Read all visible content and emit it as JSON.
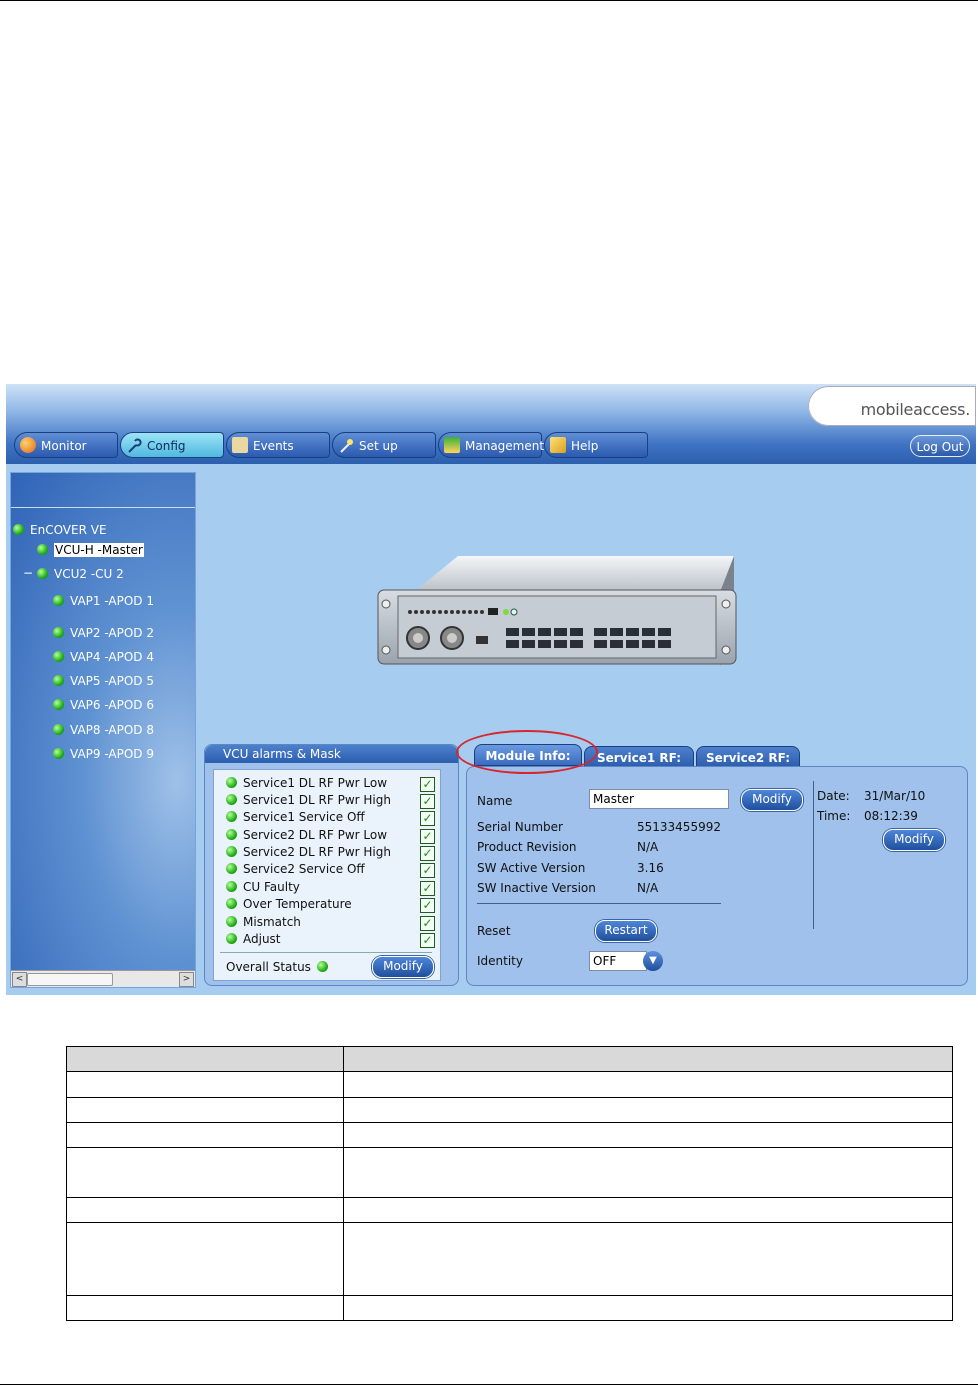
{
  "app": {
    "logo_text": "mobileaccess.",
    "logout_label": "Log Out",
    "tabs": [
      {
        "label": "Monitor",
        "icon": "monitor-icon"
      },
      {
        "label": "Config",
        "icon": "wrench-icon"
      },
      {
        "label": "Events",
        "icon": "events-icon"
      },
      {
        "label": "Set up",
        "icon": "wand-icon"
      },
      {
        "label": "Management",
        "icon": "management-icon"
      },
      {
        "label": "Help",
        "icon": "help-book-icon"
      }
    ],
    "active_tab": "Config"
  },
  "tree": {
    "root": "EnCOVER VE",
    "master": "VCU-H -Master",
    "vcu2": "VCU2 -CU 2",
    "collapse_symbol": "−",
    "items": [
      "VAP1 -APOD 1",
      "VAP2 -APOD 2",
      "VAP4 -APOD 4",
      "VAP5 -APOD 5",
      "VAP6 -APOD 6",
      "VAP8 -APOD 8",
      "VAP9 -APOD 9"
    ],
    "scroll_left": "<",
    "scroll_right": ">"
  },
  "alarms": {
    "title": "VCU alarms & Mask",
    "items": [
      "Service1 DL RF Pwr Low",
      "Service1 DL RF Pwr High",
      "Service1 Service Off",
      "Service2 DL RF Pwr Low",
      "Service2 DL RF Pwr High",
      "Service2 Service Off",
      "CU Faulty",
      "Over Temperature",
      "Mismatch",
      "Adjust"
    ],
    "checkmark": "✓",
    "overall_label": "Overall Status",
    "modify_label": "Modify"
  },
  "info": {
    "tabs": [
      "Module Info:",
      "Service1 RF:",
      "Service2 RF:"
    ],
    "name_label": "Name",
    "name_value": "Master",
    "modify_label": "Modify",
    "serial_label": "Serial Number",
    "serial_value": "55133455992",
    "revision_label": "Product Revision",
    "revision_value": "N/A",
    "sw_active_label": "SW Active Version",
    "sw_active_value": "3.16",
    "sw_inactive_label": "SW Inactive Version",
    "sw_inactive_value": "N/A",
    "reset_label": "Reset",
    "restart_label": "Restart",
    "identity_label": "Identity",
    "identity_value": "OFF",
    "date_label": "Date:",
    "date_value": "31/Mar/10",
    "time_label": "Time:",
    "time_value": "08:12:39",
    "modify2_label": "Modify",
    "dropdown_arrow": "▼"
  }
}
